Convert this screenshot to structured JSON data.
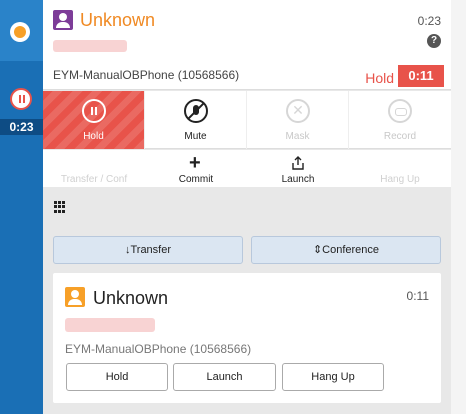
{
  "colors": {
    "rail": "#1a6fb5",
    "status_accent": "#f7a028",
    "hold_red": "#e8534a",
    "name_orange": "#f08a24",
    "avatar_purple": "#7d3c98",
    "avatar_orange": "#f7a028"
  },
  "rail": {
    "status_icon": "presence-dot-icon",
    "call_icon": "pause-circle-icon",
    "call_time": "0:23"
  },
  "active_call": {
    "name": "Unknown",
    "elapsed": "0:23",
    "help_icon": "question-circle-icon",
    "campaign": "EYM-ManualOBPhone (10568566)",
    "hold_label": "Hold",
    "hold_timer": "0:11"
  },
  "controls": [
    {
      "label": "Hold",
      "icon": "pause-circle-icon",
      "active": true
    },
    {
      "label": "Mute",
      "icon": "mic-off-icon",
      "active": false
    },
    {
      "label": "Mask",
      "icon": "close-circle-icon",
      "enabled": false
    },
    {
      "label": "Record",
      "icon": "record-icon",
      "enabled": false
    }
  ],
  "controls2": [
    {
      "label": "Transfer / Conf",
      "enabled": false
    },
    {
      "label": "Commit",
      "icon": "plus-icon"
    },
    {
      "label": "Launch",
      "icon": "share-upload-icon"
    },
    {
      "label": "Hang Up",
      "enabled": false
    }
  ],
  "keypad_icon": "keypad-grid-icon",
  "actions": {
    "transfer": "↓Transfer",
    "conference": "⇕Conference"
  },
  "second_call": {
    "name": "Unknown",
    "elapsed": "0:11",
    "campaign": "EYM-ManualOBPhone (10568566)",
    "buttons": [
      "Hold",
      "Launch",
      "Hang Up"
    ]
  }
}
